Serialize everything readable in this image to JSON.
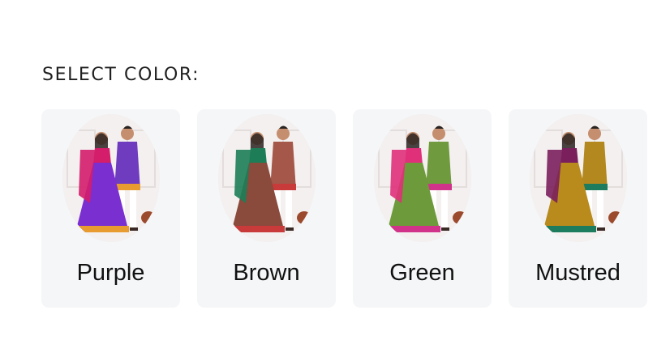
{
  "heading": "SELECT COLOR:",
  "colors": [
    {
      "label": "Purple",
      "icon": "couple-outfit-photo-icon",
      "primary": "#7a2fd0",
      "accent": "#d41d6b",
      "man": "#6f3bbf",
      "border": "#e89b2f"
    },
    {
      "label": "Brown",
      "icon": "couple-outfit-photo-icon",
      "primary": "#8a4a3c",
      "accent": "#1c7d56",
      "man": "#a5574a",
      "border": "#c93a3a"
    },
    {
      "label": "Green",
      "icon": "couple-outfit-photo-icon",
      "primary": "#6d9a3a",
      "accent": "#e0307a",
      "man": "#6f9a3d",
      "border": "#d1338a"
    },
    {
      "label": "Mustred",
      "icon": "couple-outfit-photo-icon",
      "primary": "#b98a1c",
      "accent": "#7a1f5c",
      "man": "#b3891f",
      "border": "#1d7c5e"
    }
  ]
}
